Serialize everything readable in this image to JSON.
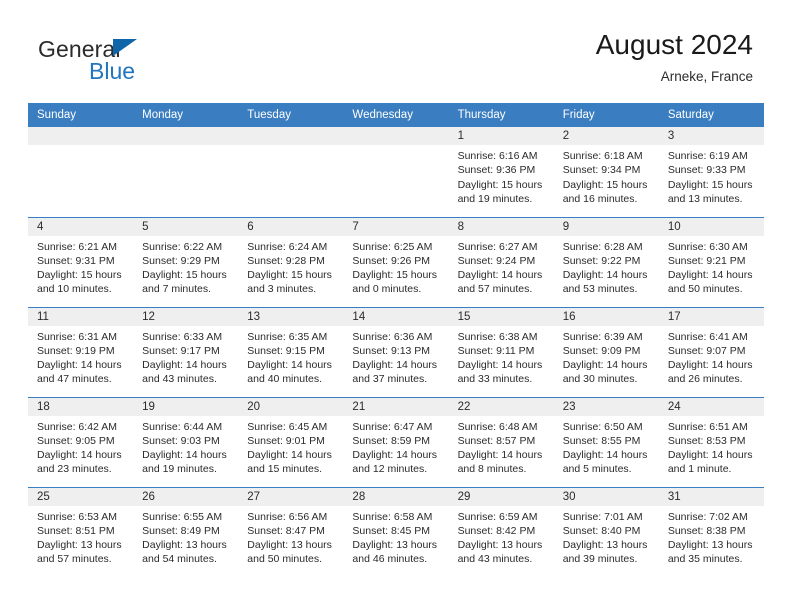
{
  "brand": {
    "name_part1": "General",
    "name_part2": "Blue",
    "triangle_icon": "triangle-icon",
    "accent_blue": "#2176bd",
    "header_blue": "#3a7dc0",
    "strip_gray": "#efefef"
  },
  "header": {
    "title": "August 2024",
    "subtitle": "Arneke, France"
  },
  "weekday_headers": [
    "Sunday",
    "Monday",
    "Tuesday",
    "Wednesday",
    "Thursday",
    "Friday",
    "Saturday"
  ],
  "weeks": [
    [
      {
        "day": "",
        "sunrise": "",
        "sunset": "",
        "daylight": "",
        "empty": true
      },
      {
        "day": "",
        "sunrise": "",
        "sunset": "",
        "daylight": "",
        "empty": true
      },
      {
        "day": "",
        "sunrise": "",
        "sunset": "",
        "daylight": "",
        "empty": true
      },
      {
        "day": "",
        "sunrise": "",
        "sunset": "",
        "daylight": "",
        "empty": true
      },
      {
        "day": "1",
        "sunrise": "Sunrise: 6:16 AM",
        "sunset": "Sunset: 9:36 PM",
        "daylight": "Daylight: 15 hours and 19 minutes."
      },
      {
        "day": "2",
        "sunrise": "Sunrise: 6:18 AM",
        "sunset": "Sunset: 9:34 PM",
        "daylight": "Daylight: 15 hours and 16 minutes."
      },
      {
        "day": "3",
        "sunrise": "Sunrise: 6:19 AM",
        "sunset": "Sunset: 9:33 PM",
        "daylight": "Daylight: 15 hours and 13 minutes."
      }
    ],
    [
      {
        "day": "4",
        "sunrise": "Sunrise: 6:21 AM",
        "sunset": "Sunset: 9:31 PM",
        "daylight": "Daylight: 15 hours and 10 minutes."
      },
      {
        "day": "5",
        "sunrise": "Sunrise: 6:22 AM",
        "sunset": "Sunset: 9:29 PM",
        "daylight": "Daylight: 15 hours and 7 minutes."
      },
      {
        "day": "6",
        "sunrise": "Sunrise: 6:24 AM",
        "sunset": "Sunset: 9:28 PM",
        "daylight": "Daylight: 15 hours and 3 minutes."
      },
      {
        "day": "7",
        "sunrise": "Sunrise: 6:25 AM",
        "sunset": "Sunset: 9:26 PM",
        "daylight": "Daylight: 15 hours and 0 minutes."
      },
      {
        "day": "8",
        "sunrise": "Sunrise: 6:27 AM",
        "sunset": "Sunset: 9:24 PM",
        "daylight": "Daylight: 14 hours and 57 minutes."
      },
      {
        "day": "9",
        "sunrise": "Sunrise: 6:28 AM",
        "sunset": "Sunset: 9:22 PM",
        "daylight": "Daylight: 14 hours and 53 minutes."
      },
      {
        "day": "10",
        "sunrise": "Sunrise: 6:30 AM",
        "sunset": "Sunset: 9:21 PM",
        "daylight": "Daylight: 14 hours and 50 minutes."
      }
    ],
    [
      {
        "day": "11",
        "sunrise": "Sunrise: 6:31 AM",
        "sunset": "Sunset: 9:19 PM",
        "daylight": "Daylight: 14 hours and 47 minutes."
      },
      {
        "day": "12",
        "sunrise": "Sunrise: 6:33 AM",
        "sunset": "Sunset: 9:17 PM",
        "daylight": "Daylight: 14 hours and 43 minutes."
      },
      {
        "day": "13",
        "sunrise": "Sunrise: 6:35 AM",
        "sunset": "Sunset: 9:15 PM",
        "daylight": "Daylight: 14 hours and 40 minutes."
      },
      {
        "day": "14",
        "sunrise": "Sunrise: 6:36 AM",
        "sunset": "Sunset: 9:13 PM",
        "daylight": "Daylight: 14 hours and 37 minutes."
      },
      {
        "day": "15",
        "sunrise": "Sunrise: 6:38 AM",
        "sunset": "Sunset: 9:11 PM",
        "daylight": "Daylight: 14 hours and 33 minutes."
      },
      {
        "day": "16",
        "sunrise": "Sunrise: 6:39 AM",
        "sunset": "Sunset: 9:09 PM",
        "daylight": "Daylight: 14 hours and 30 minutes."
      },
      {
        "day": "17",
        "sunrise": "Sunrise: 6:41 AM",
        "sunset": "Sunset: 9:07 PM",
        "daylight": "Daylight: 14 hours and 26 minutes."
      }
    ],
    [
      {
        "day": "18",
        "sunrise": "Sunrise: 6:42 AM",
        "sunset": "Sunset: 9:05 PM",
        "daylight": "Daylight: 14 hours and 23 minutes."
      },
      {
        "day": "19",
        "sunrise": "Sunrise: 6:44 AM",
        "sunset": "Sunset: 9:03 PM",
        "daylight": "Daylight: 14 hours and 19 minutes."
      },
      {
        "day": "20",
        "sunrise": "Sunrise: 6:45 AM",
        "sunset": "Sunset: 9:01 PM",
        "daylight": "Daylight: 14 hours and 15 minutes."
      },
      {
        "day": "21",
        "sunrise": "Sunrise: 6:47 AM",
        "sunset": "Sunset: 8:59 PM",
        "daylight": "Daylight: 14 hours and 12 minutes."
      },
      {
        "day": "22",
        "sunrise": "Sunrise: 6:48 AM",
        "sunset": "Sunset: 8:57 PM",
        "daylight": "Daylight: 14 hours and 8 minutes."
      },
      {
        "day": "23",
        "sunrise": "Sunrise: 6:50 AM",
        "sunset": "Sunset: 8:55 PM",
        "daylight": "Daylight: 14 hours and 5 minutes."
      },
      {
        "day": "24",
        "sunrise": "Sunrise: 6:51 AM",
        "sunset": "Sunset: 8:53 PM",
        "daylight": "Daylight: 14 hours and 1 minute."
      }
    ],
    [
      {
        "day": "25",
        "sunrise": "Sunrise: 6:53 AM",
        "sunset": "Sunset: 8:51 PM",
        "daylight": "Daylight: 13 hours and 57 minutes."
      },
      {
        "day": "26",
        "sunrise": "Sunrise: 6:55 AM",
        "sunset": "Sunset: 8:49 PM",
        "daylight": "Daylight: 13 hours and 54 minutes."
      },
      {
        "day": "27",
        "sunrise": "Sunrise: 6:56 AM",
        "sunset": "Sunset: 8:47 PM",
        "daylight": "Daylight: 13 hours and 50 minutes."
      },
      {
        "day": "28",
        "sunrise": "Sunrise: 6:58 AM",
        "sunset": "Sunset: 8:45 PM",
        "daylight": "Daylight: 13 hours and 46 minutes."
      },
      {
        "day": "29",
        "sunrise": "Sunrise: 6:59 AM",
        "sunset": "Sunset: 8:42 PM",
        "daylight": "Daylight: 13 hours and 43 minutes."
      },
      {
        "day": "30",
        "sunrise": "Sunrise: 7:01 AM",
        "sunset": "Sunset: 8:40 PM",
        "daylight": "Daylight: 13 hours and 39 minutes."
      },
      {
        "day": "31",
        "sunrise": "Sunrise: 7:02 AM",
        "sunset": "Sunset: 8:38 PM",
        "daylight": "Daylight: 13 hours and 35 minutes."
      }
    ]
  ]
}
